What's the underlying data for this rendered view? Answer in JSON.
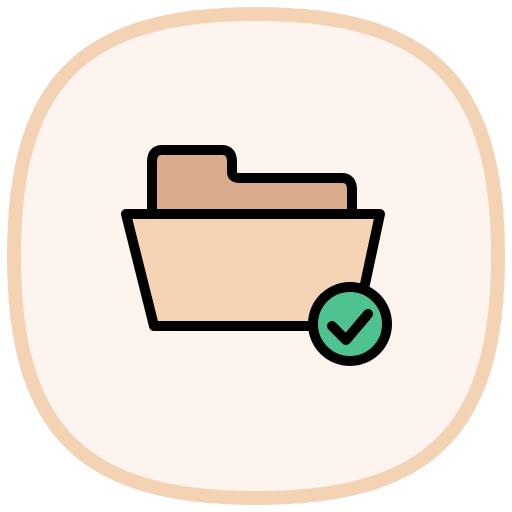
{
  "icon": {
    "name": "folder-check-icon",
    "tile_background": "#fdf4ef",
    "tile_border": "#f3d3b3",
    "folder_back": "#d9ab8b",
    "folder_front": "#f5d3b5",
    "outline": "#000000",
    "check_badge": "#4fc38f"
  }
}
